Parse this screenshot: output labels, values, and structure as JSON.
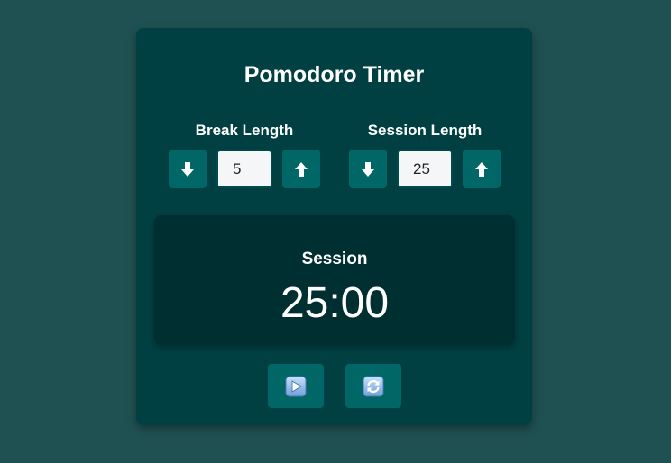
{
  "app": {
    "title": "Pomodoro Timer"
  },
  "break": {
    "label": "Break Length",
    "value": "5",
    "decrement_icon": "arrow-down-icon",
    "increment_icon": "arrow-up-icon"
  },
  "session": {
    "label": "Session Length",
    "value": "25",
    "decrement_icon": "arrow-down-icon",
    "increment_icon": "arrow-up-icon"
  },
  "timer": {
    "label": "Session",
    "time_left": "25:00"
  },
  "controls": {
    "start_icon": "play-icon",
    "reset_icon": "refresh-icon"
  },
  "colors": {
    "page_background": "#1f5152",
    "card_background": "#004043",
    "display_background": "#002f32",
    "button_background": "#006666",
    "text": "#ffffff"
  }
}
